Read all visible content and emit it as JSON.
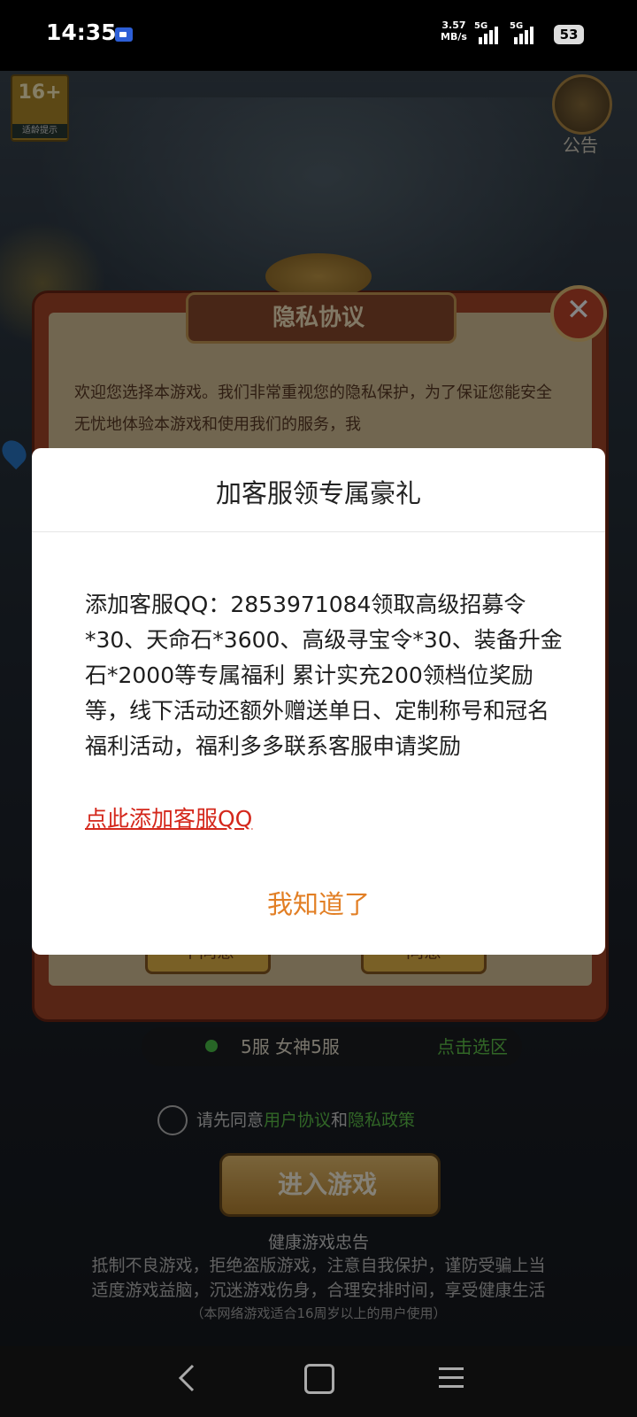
{
  "status_bar": {
    "time": "14:35",
    "net_speed": "3.57",
    "net_speed_unit": "MB/s",
    "sim1": "5G",
    "sim2": "5G",
    "battery": "53"
  },
  "game": {
    "age_rating": "16+",
    "age_caption": "适龄提示",
    "notice_label": "公告",
    "server_name": "5服 女神5服",
    "server_pick": "点击选区",
    "agree_prefix": "请先同意",
    "user_agreement": "用户协议",
    "agree_and": "和",
    "privacy_policy": "隐私政策",
    "enter_button": "进入游戏",
    "health_title": "健康游戏忠告",
    "health_line1": "抵制不良游戏，拒绝盗版游戏，注意自我保护，谨防受骗上当",
    "health_line2": "适度游戏益脑，沉迷游戏伤身，合理安排时间，享受健康生活",
    "health_note": "（本网络游戏适合16周岁以上的用户使用）"
  },
  "privacy_dialog": {
    "title": "隐私协议",
    "text": "欢迎您选择本游戏。我们非常重视您的隐私保护，为了保证您能安全无忧地体验本游戏和使用我们的服务，我",
    "disagree": "不同意",
    "agree": "同意"
  },
  "dialog": {
    "title": "加客服领专属豪礼",
    "body": "添加客服QQ：2853971084领取高级招募令*30、天命石*3600、高级寻宝令*30、装备升金石*2000等专属福利 累计实充200领档位奖励等，线下活动还额外赠送单日、定制称号和冠名福利活动，福利多多联系客服申请奖励",
    "link": "点此添加客服QQ",
    "ok": "我知道了"
  },
  "colors": {
    "link": "#d4271b",
    "ok_button": "#e27f25",
    "agreement_green": "#5fc34a"
  }
}
